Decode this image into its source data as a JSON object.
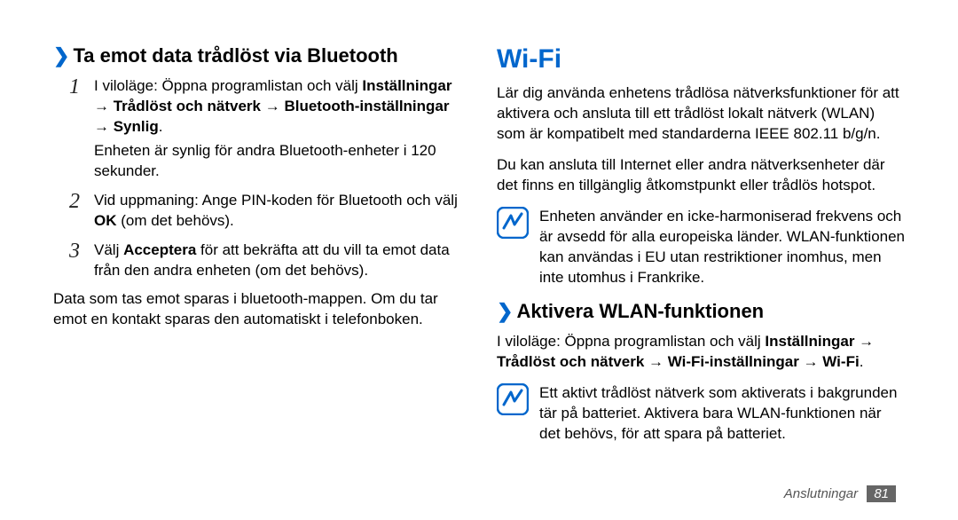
{
  "left": {
    "heading": "Ta emot data trådlöst via Bluetooth",
    "steps": [
      {
        "num": "1",
        "pre": "I viloläge: Öppna programlistan och välj ",
        "bold": "Inställningar → Trådlöst och nätverk → Bluetooth-inställningar → Synlig",
        "post": ".",
        "extra": "Enheten är synlig för andra Bluetooth-enheter i 120 sekunder."
      },
      {
        "num": "2",
        "pre": "Vid uppmaning: Ange PIN-koden för Bluetooth och välj ",
        "bold": "OK",
        "post": " (om det behövs)."
      },
      {
        "num": "3",
        "pre": "Välj ",
        "bold": "Acceptera",
        "post": " för att bekräfta att du vill ta emot data från den andra enheten (om det behövs)."
      }
    ],
    "footer_para": "Data som tas emot sparas i bluetooth-mappen. Om du tar emot en kontakt sparas den automatiskt i telefonboken."
  },
  "right": {
    "heading": "Wi-Fi",
    "para1": "Lär dig använda enhetens trådlösa nätverksfunktioner för att aktivera och ansluta till ett trådlöst lokalt nätverk (WLAN) som är kompatibelt med standarderna IEEE 802.11 b/g/n.",
    "para2": "Du kan ansluta till Internet eller andra nätverksenheter där det finns en tillgänglig åtkomstpunkt eller trådlös hotspot.",
    "note1": "Enheten använder en icke-harmoniserad frekvens och är avsedd för alla europeiska länder. WLAN-funktionen kan användas i EU utan restriktioner inomhus, men inte utomhus i Frankrike.",
    "subheading": "Aktivera WLAN-funktionen",
    "instr_pre": "I viloläge: Öppna programlistan och välj ",
    "instr_bold": "Inställningar → Trådlöst och nätverk → Wi-Fi-inställningar → Wi-Fi",
    "instr_post": ".",
    "note2": "Ett aktivt trådlöst nätverk som aktiverats i bakgrunden tär på batteriet. Aktivera bara WLAN-funktionen när det behövs, för att spara på batteriet."
  },
  "footer": {
    "label": "Anslutningar",
    "page": "81"
  }
}
